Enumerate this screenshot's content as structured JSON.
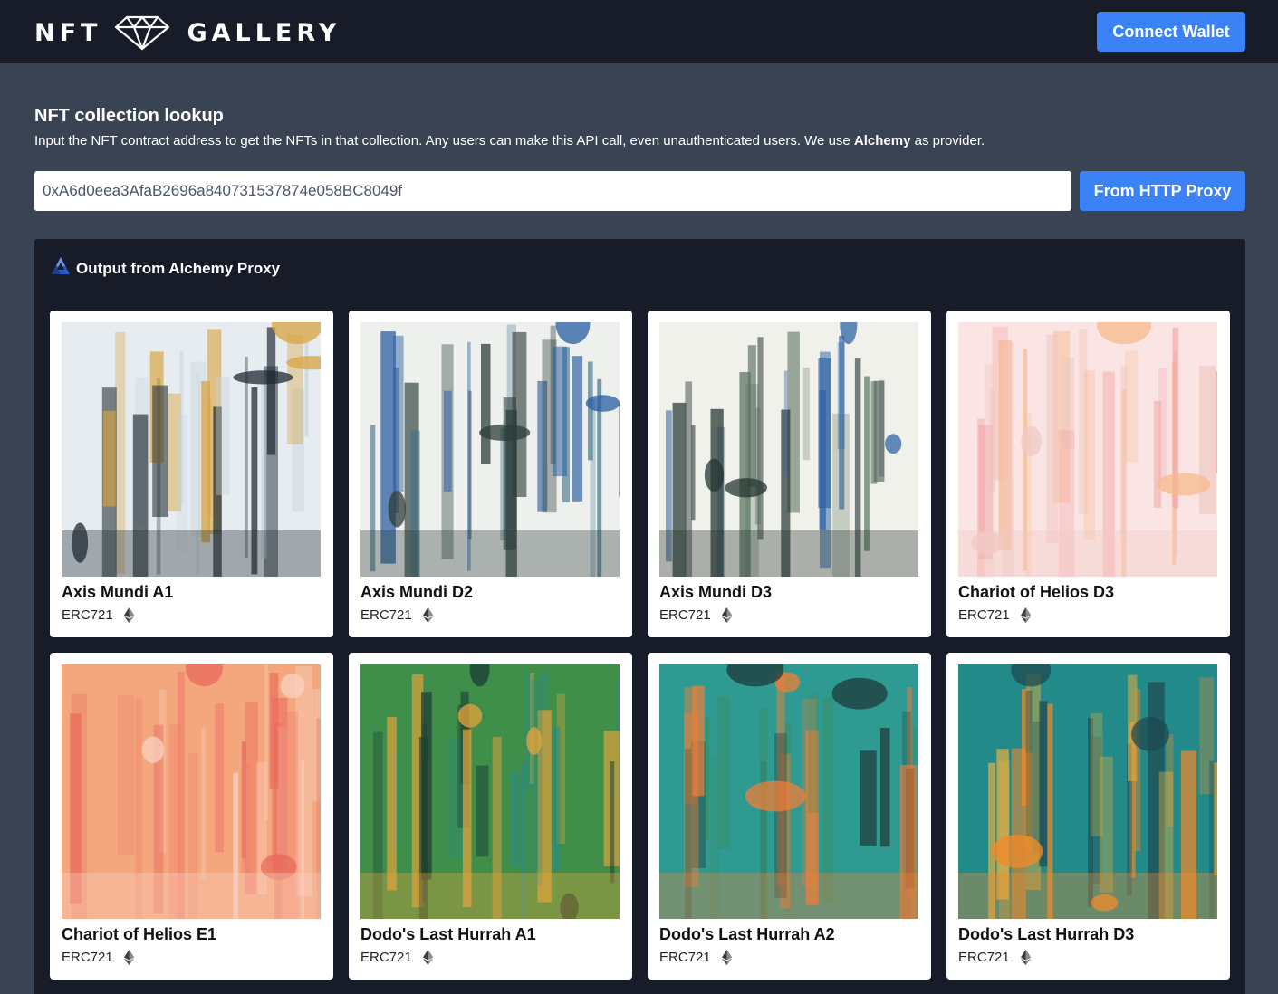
{
  "header": {
    "logo_left": "NFT",
    "logo_right": "GALLERY",
    "connect_label": "Connect Wallet"
  },
  "lookup": {
    "title": "NFT collection lookup",
    "description_pre": "Input the NFT contract address to get the NFTs in that collection. Any users can make this API call, even unauthenticated users. We use ",
    "description_bold": "Alchemy",
    "description_post": " as provider.",
    "address_value": "0xA6d0eea3AfaB2696a840731537874e058BC8049f",
    "button_label": "From HTTP Proxy"
  },
  "output": {
    "title": "Output from Alchemy Proxy",
    "cards": [
      {
        "name": "Axis Mundi A1",
        "standard": "ERC721",
        "palette": [
          "#e6ecef",
          "#c5d3dc",
          "#1f2a33",
          "#d9a441"
        ]
      },
      {
        "name": "Axis Mundi D2",
        "standard": "ERC721",
        "palette": [
          "#eef0ee",
          "#3b6f86",
          "#2c3d3a",
          "#2a5ea0"
        ]
      },
      {
        "name": "Axis Mundi D3",
        "standard": "ERC721",
        "palette": [
          "#f1f1ec",
          "#56705a",
          "#253532",
          "#2f64a6"
        ]
      },
      {
        "name": "Chariot of Helios D3",
        "standard": "ERC721",
        "palette": [
          "#fbe5e4",
          "#f2a3a6",
          "#f0c9c3",
          "#f7b98e"
        ]
      },
      {
        "name": "Chariot of Helios E1",
        "standard": "ERC721",
        "palette": [
          "#f4a77d",
          "#f07f6c",
          "#f9d2c2",
          "#e86a5c"
        ]
      },
      {
        "name": "Dodo's Last Hurrah A1",
        "standard": "ERC721",
        "palette": [
          "#3f8f4a",
          "#2a8a86",
          "#e8a33b",
          "#1c3c35"
        ]
      },
      {
        "name": "Dodo's Last Hurrah A2",
        "standard": "ERC721",
        "palette": [
          "#2f9a91",
          "#3a8f63",
          "#f07d38",
          "#1f3a3a"
        ]
      },
      {
        "name": "Dodo's Last Hurrah D3",
        "standard": "ERC721",
        "palette": [
          "#238a8a",
          "#f4b23a",
          "#f48a2a",
          "#1e4a52"
        ]
      }
    ]
  }
}
